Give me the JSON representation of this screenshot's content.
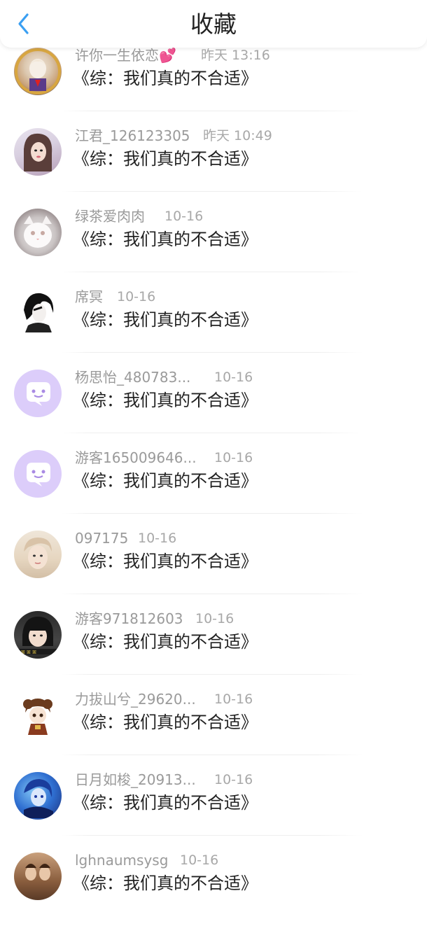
{
  "header": {
    "title": "收藏",
    "back_icon": "chevron-left-icon",
    "accent_color": "#3a9ff2"
  },
  "favorites": [
    {
      "user": "许你一生依恋💕",
      "time": "昨天 13:16",
      "book": "《综：我们真的不合适》",
      "avatar": "photo-avatar"
    },
    {
      "user": "江君_126123305",
      "time": "昨天 10:49",
      "book": "《综：我们真的不合适》",
      "avatar": "photo-avatar"
    },
    {
      "user": "绿茶爱肉肉",
      "time": "10-16",
      "book": "《综：我们真的不合适》",
      "avatar": "photo-avatar"
    },
    {
      "user": "席冥",
      "time": "10-16",
      "book": "《综：我们真的不合适》",
      "avatar": "photo-avatar"
    },
    {
      "user": "杨思怡_480783...",
      "time": "10-16",
      "book": "《综：我们真的不合适》",
      "avatar": "default-chat-avatar"
    },
    {
      "user": "游客165009646...",
      "time": "10-16",
      "book": "《综：我们真的不合适》",
      "avatar": "default-chat-avatar"
    },
    {
      "user": "097175",
      "time": "10-16",
      "book": "《综：我们真的不合适》",
      "avatar": "photo-avatar"
    },
    {
      "user": "游客971812603",
      "time": "10-16",
      "book": "《综：我们真的不合适》",
      "avatar": "photo-avatar"
    },
    {
      "user": "力拔山兮_29620...",
      "time": "10-16",
      "book": "《综：我们真的不合适》",
      "avatar": "photo-avatar"
    },
    {
      "user": "日月如梭_20913...",
      "time": "10-16",
      "book": "《综：我们真的不合适》",
      "avatar": "photo-avatar"
    },
    {
      "user": "lghnaumsysg",
      "time": "10-16",
      "book": "《综：我们真的不合适》",
      "avatar": "photo-avatar"
    }
  ]
}
